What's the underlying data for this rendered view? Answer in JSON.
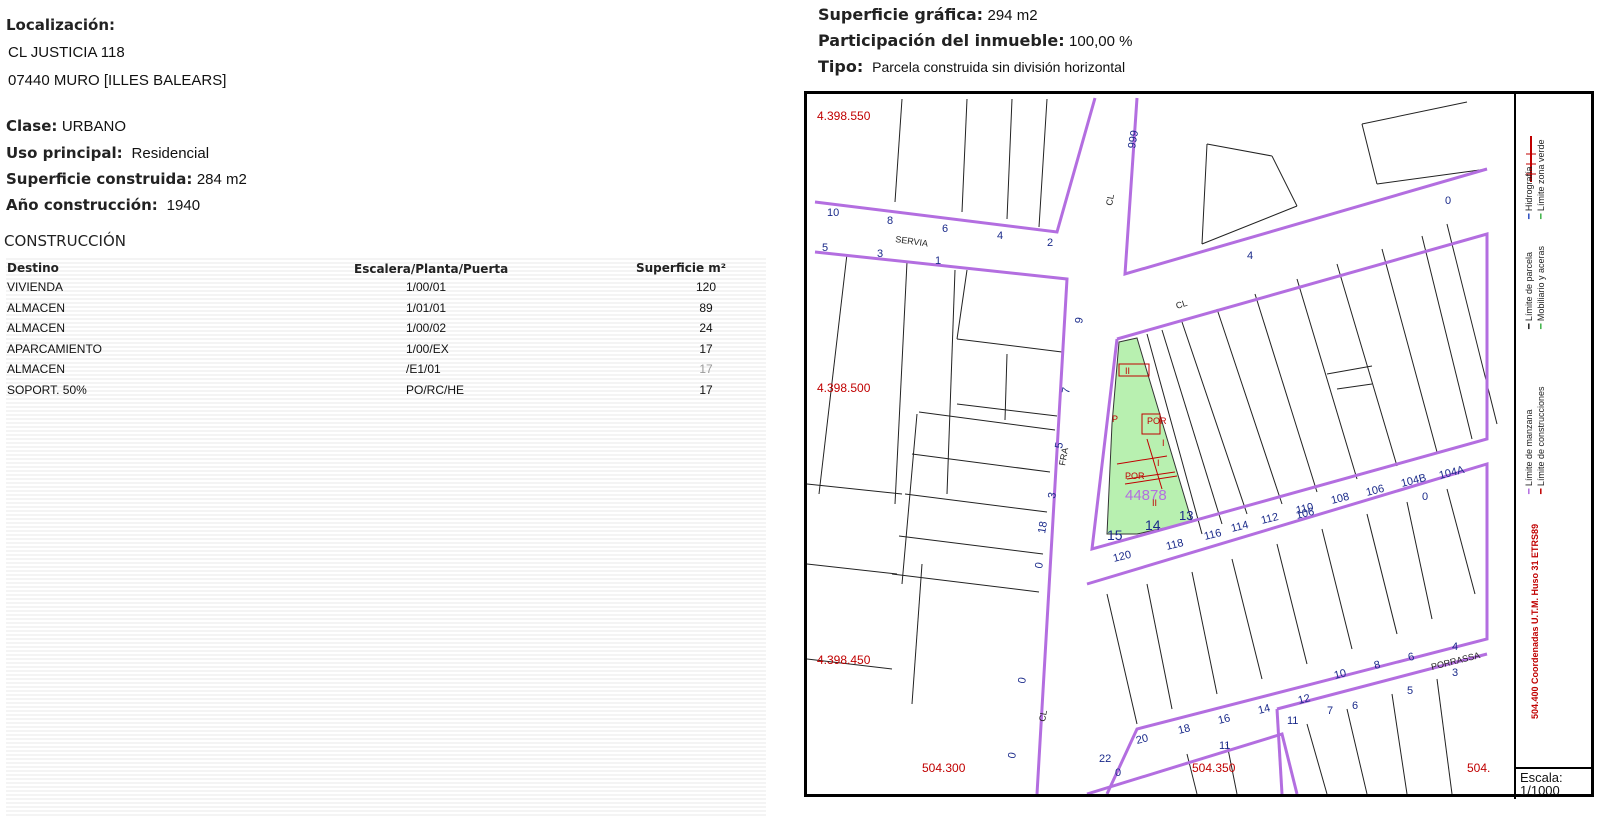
{
  "left": {
    "localizacion_label": "Localización:",
    "address_line1": "CL JUSTICIA 118",
    "address_line2": "07440 MURO [ILLES BALEARS]",
    "clase_label": "Clase:",
    "clase_value": "URBANO",
    "uso_label": "Uso principal:",
    "uso_value": "Residencial",
    "superficie_label": "Superficie construida:",
    "superficie_value": "284 m2",
    "anio_label": "Año construcción:",
    "anio_value": "1940",
    "construccion_title": "CONSTRUCCIÓN",
    "table": {
      "headers": [
        "Destino",
        "Escalera/Planta/Puerta",
        "Superficie m²"
      ],
      "rows": [
        [
          "VIVIENDA",
          "1/00/01",
          "120"
        ],
        [
          "ALMACEN",
          "1/01/01",
          "89"
        ],
        [
          "ALMACEN",
          "1/00/02",
          "24"
        ],
        [
          "APARCAMIENTO",
          "1/00/EX",
          "17"
        ],
        [
          "ALMACEN",
          "/E1/01",
          "17"
        ],
        [
          "SOPORT. 50%",
          "PO/RC/HE",
          "17"
        ]
      ]
    }
  },
  "right": {
    "sup_grafica_label": "Superficie gráfica:",
    "sup_grafica_value": "294 m2",
    "participacion_label": "Participación del inmueble:",
    "participacion_value": "100,00 %",
    "tipo_label": "Tipo:",
    "tipo_value": "Parcela construida sin división horizontal"
  },
  "map": {
    "coords": {
      "y1": "4.398.550",
      "y2": "4.398.500",
      "y3": "4.398.450",
      "x1": "504.300",
      "x2": "504.350",
      "x3": "504."
    },
    "parcel_ref": "44878",
    "street_labels": [
      "SERVIA",
      "CL",
      "CL",
      "CL",
      "FRA",
      "PORRASSA"
    ],
    "numbers": [
      "10",
      "8",
      "6",
      "4",
      "2",
      "5",
      "3",
      "1",
      "999",
      "0",
      "4",
      "9",
      "7",
      "5",
      "3",
      "18",
      "0",
      "0",
      "0",
      "15",
      "14",
      "13",
      "120",
      "118",
      "116",
      "114",
      "112",
      "110",
      "106",
      "108",
      "106",
      "104B",
      "104A",
      "0",
      "22",
      "20",
      "18",
      "16",
      "14",
      "12",
      "10",
      "8",
      "6",
      "4",
      "11",
      "7",
      "6",
      "5",
      "3",
      "11",
      "0"
    ],
    "unit_labels": [
      "II",
      "P",
      "POR",
      "I",
      "POR",
      "I",
      "II"
    ],
    "legend": {
      "manzana": "Límite de manzana",
      "construcciones": "Límite de construcciones",
      "parcela": "Límite de parcela",
      "mobiliario": "Mobiliario y aceras",
      "hidrografia": "Hidrografía",
      "zona_verde": "Límite zona verde",
      "utm": "504.400 Coordenadas U.T.M. Huso 31 ETRS89"
    },
    "scale_label": "Escala:",
    "scale_value": "1/1000"
  },
  "colors": {
    "manzana": "#b36ee0",
    "parcel_fill": "#b8f0b0",
    "coord_red": "#c00000",
    "number_blue": "#1a2a8a",
    "hidrografia": "#2c4fc2",
    "zona_verde": "#3fb34a"
  }
}
